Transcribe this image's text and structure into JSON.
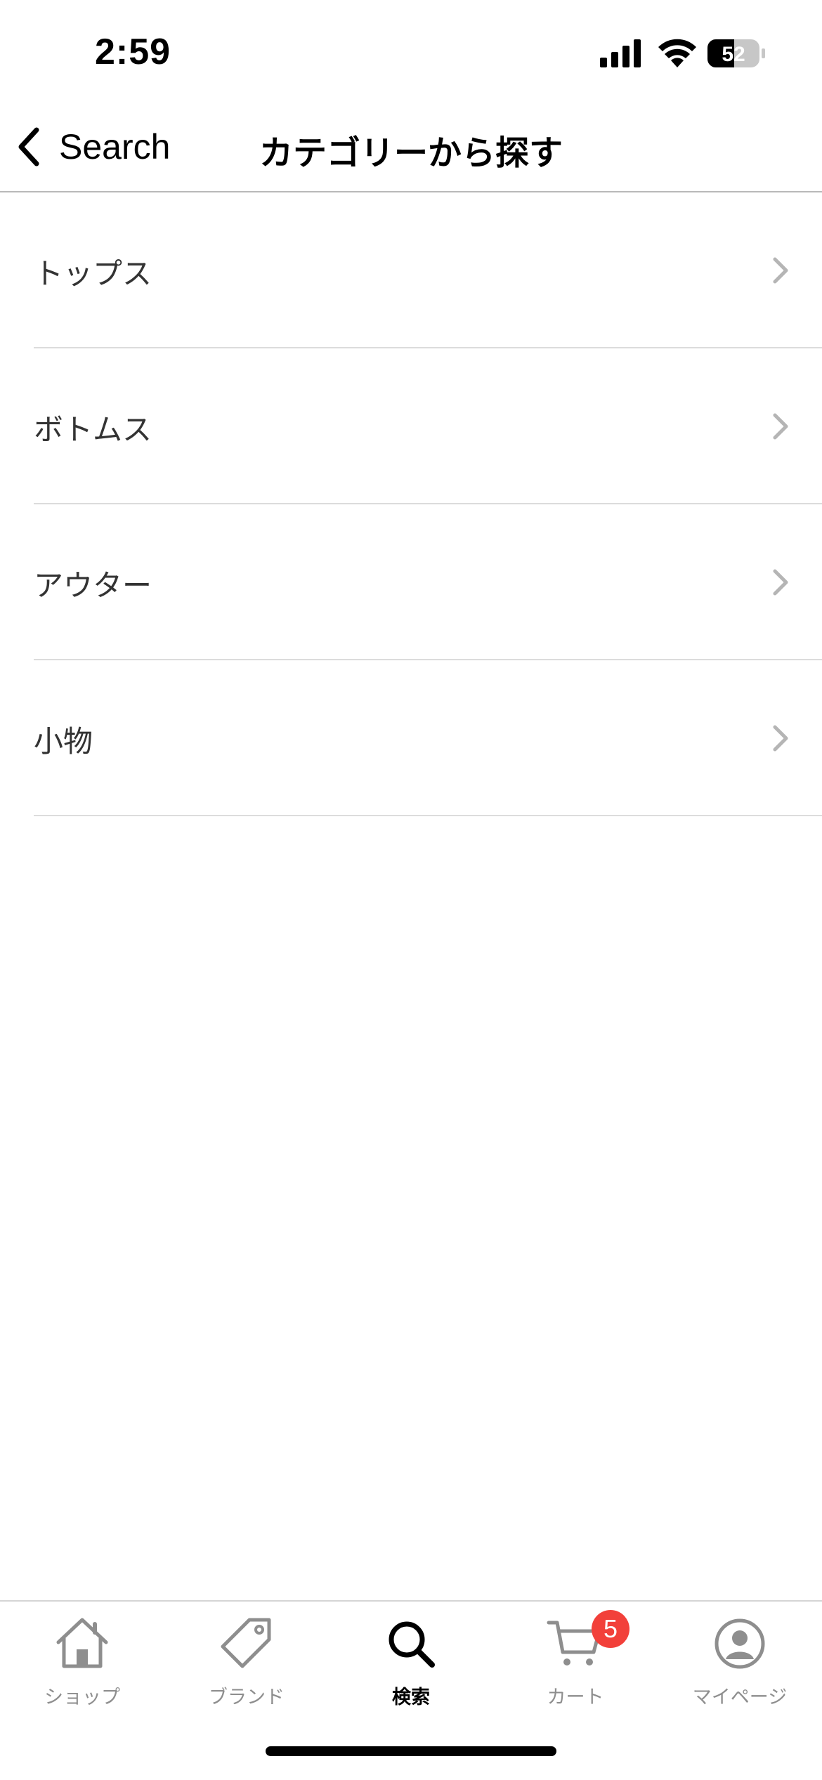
{
  "status_bar": {
    "time": "2:59",
    "battery_level": "52",
    "battery_percent": 52
  },
  "nav": {
    "back_label": "Search",
    "title": "カテゴリーから探す"
  },
  "categories": [
    {
      "label": "トップス"
    },
    {
      "label": "ボトムス"
    },
    {
      "label": "アウター"
    },
    {
      "label": "小物"
    }
  ],
  "tab_bar": {
    "items": [
      {
        "label": "ショップ",
        "icon": "home-icon"
      },
      {
        "label": "ブランド",
        "icon": "tag-icon"
      },
      {
        "label": "検索",
        "icon": "search-icon",
        "active": true
      },
      {
        "label": "カート",
        "icon": "cart-icon",
        "badge": "5"
      },
      {
        "label": "マイページ",
        "icon": "profile-icon"
      }
    ]
  },
  "colors": {
    "badge": "#f2403a",
    "inactive_tab": "#8e8e8e",
    "divider": "#dcdcdc"
  }
}
